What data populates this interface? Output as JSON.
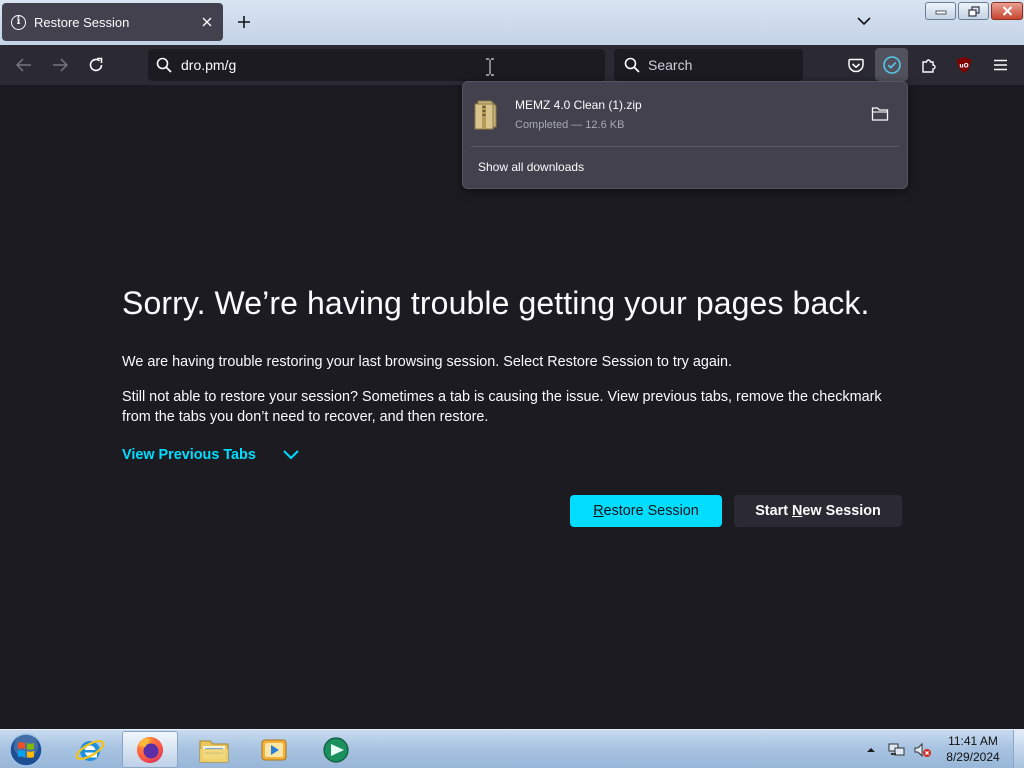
{
  "tab": {
    "title": "Restore Session"
  },
  "navbar": {
    "url": "dro.pm/g",
    "search_placeholder": "Search"
  },
  "downloads": {
    "items": [
      {
        "name": "MEMZ 4.0 Clean (1).zip",
        "status": "Completed — 12.6 KB"
      }
    ],
    "show_all": "Show all downloads"
  },
  "page": {
    "title": "Sorry. We’re having trouble getting your pages back.",
    "p1": "We are having trouble restoring your last browsing session. Select Restore Session to try again.",
    "p2": "Still not able to restore your session? Sometimes a tab is causing the issue. View previous tabs, remove the checkmark from the tabs you don’t need to recover, and then restore.",
    "view_previous": "View Previous Tabs",
    "restore_label": "Restore Session",
    "new_session_prefix": "Start ",
    "new_session_accel": "N",
    "new_session_suffix": "ew Session"
  },
  "taskbar": {
    "time": "11:41 AM",
    "date": "8/29/2024"
  },
  "colors": {
    "accent": "#00ddff",
    "page_bg": "#1c1b22",
    "toolbar_bg": "#2b2a33"
  }
}
